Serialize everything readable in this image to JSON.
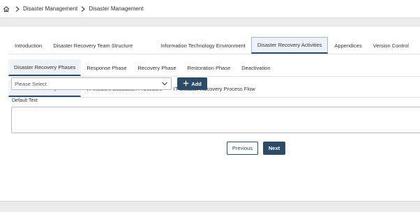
{
  "breadcrumb": {
    "home_icon": "home-icon",
    "items": [
      "Disaster Management",
      "Disaster Management"
    ]
  },
  "main_tabs": [
    {
      "label": "Introduction",
      "active": false
    },
    {
      "label": "Disaster Recovery Team Structure",
      "active": false
    },
    {
      "label": "Information Technology Environment",
      "active": false
    },
    {
      "label": "Disaster Recovery Activities",
      "active": true
    },
    {
      "label": "Appendices",
      "active": false
    },
    {
      "label": "Version Control",
      "active": false
    }
  ],
  "sub_tabs": [
    {
      "label": "Disaster Recovery Phases",
      "active": true
    },
    {
      "label": "Response Phase",
      "active": false
    },
    {
      "label": "Recovery Phase",
      "active": false
    },
    {
      "label": "Restoration Phase",
      "active": false
    },
    {
      "label": "Deactivation",
      "active": false
    }
  ],
  "sub_sub_tabs": [
    {
      "label": "Disaster Recovery Phases",
      "active": true
    },
    {
      "label": "IT Incident Escalation Procedure",
      "active": false
    },
    {
      "label": "IT Disaster Recovery Process Flow",
      "active": false
    }
  ],
  "form": {
    "select_value": "Please Select",
    "add_label": "Add",
    "default_text_label": "Default Text",
    "default_text_value": ""
  },
  "nav": {
    "previous_label": "Previous",
    "next_label": "Next"
  },
  "colors": {
    "accent": "#2e4a66",
    "background": "#ececec"
  }
}
